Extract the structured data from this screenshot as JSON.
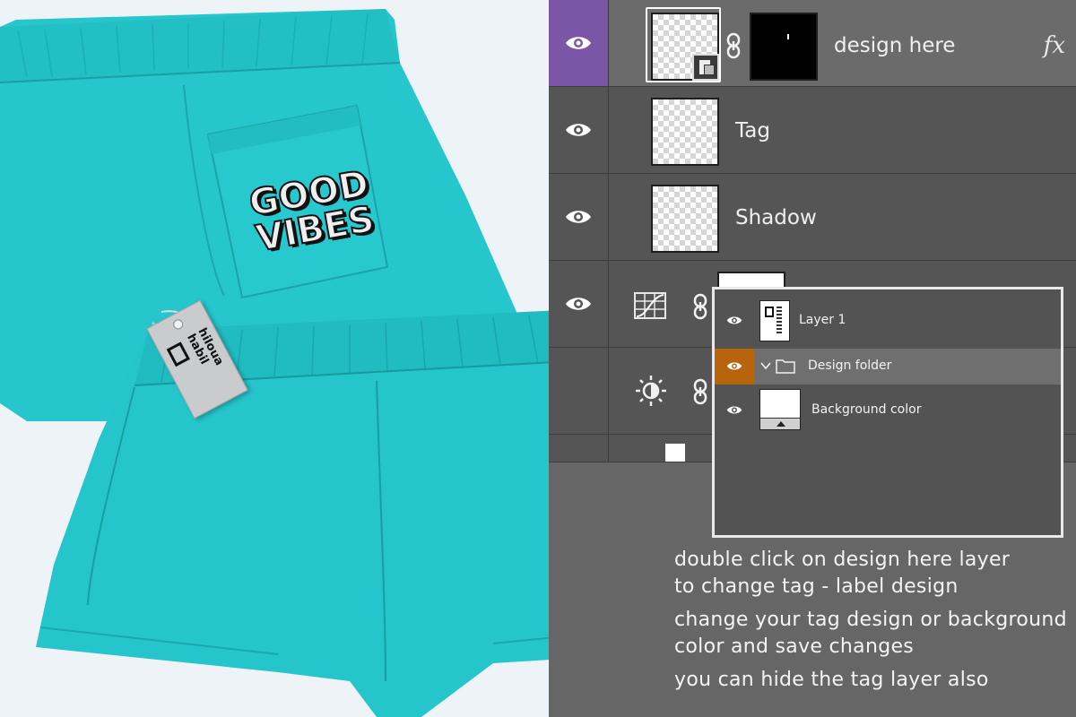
{
  "layers_panel": {
    "layers": [
      {
        "name": "design here",
        "fx": "fx",
        "selected": true
      },
      {
        "name": "Tag",
        "selected": false
      },
      {
        "name": "Shadow",
        "selected": false
      }
    ]
  },
  "folder_panel": {
    "items": [
      {
        "name": "Layer 1"
      },
      {
        "name": "Design folder"
      },
      {
        "name": "Background color"
      }
    ]
  },
  "instructions": [
    "double click on design here layer",
    "to change tag - label design",
    "change your tag design or background",
    "color and save changes",
    "you can hide the tag layer also"
  ],
  "mockup": {
    "print_line1": "GOOD",
    "print_line2": "VIBES",
    "tag_brand_line1": "habil",
    "tag_brand_line2": "hiloua"
  },
  "colors": {
    "shorts": "#24c5cb",
    "selected_layer": "#7b55a6",
    "folder_eye": "#b8640c",
    "panel_bg": "#555555"
  }
}
